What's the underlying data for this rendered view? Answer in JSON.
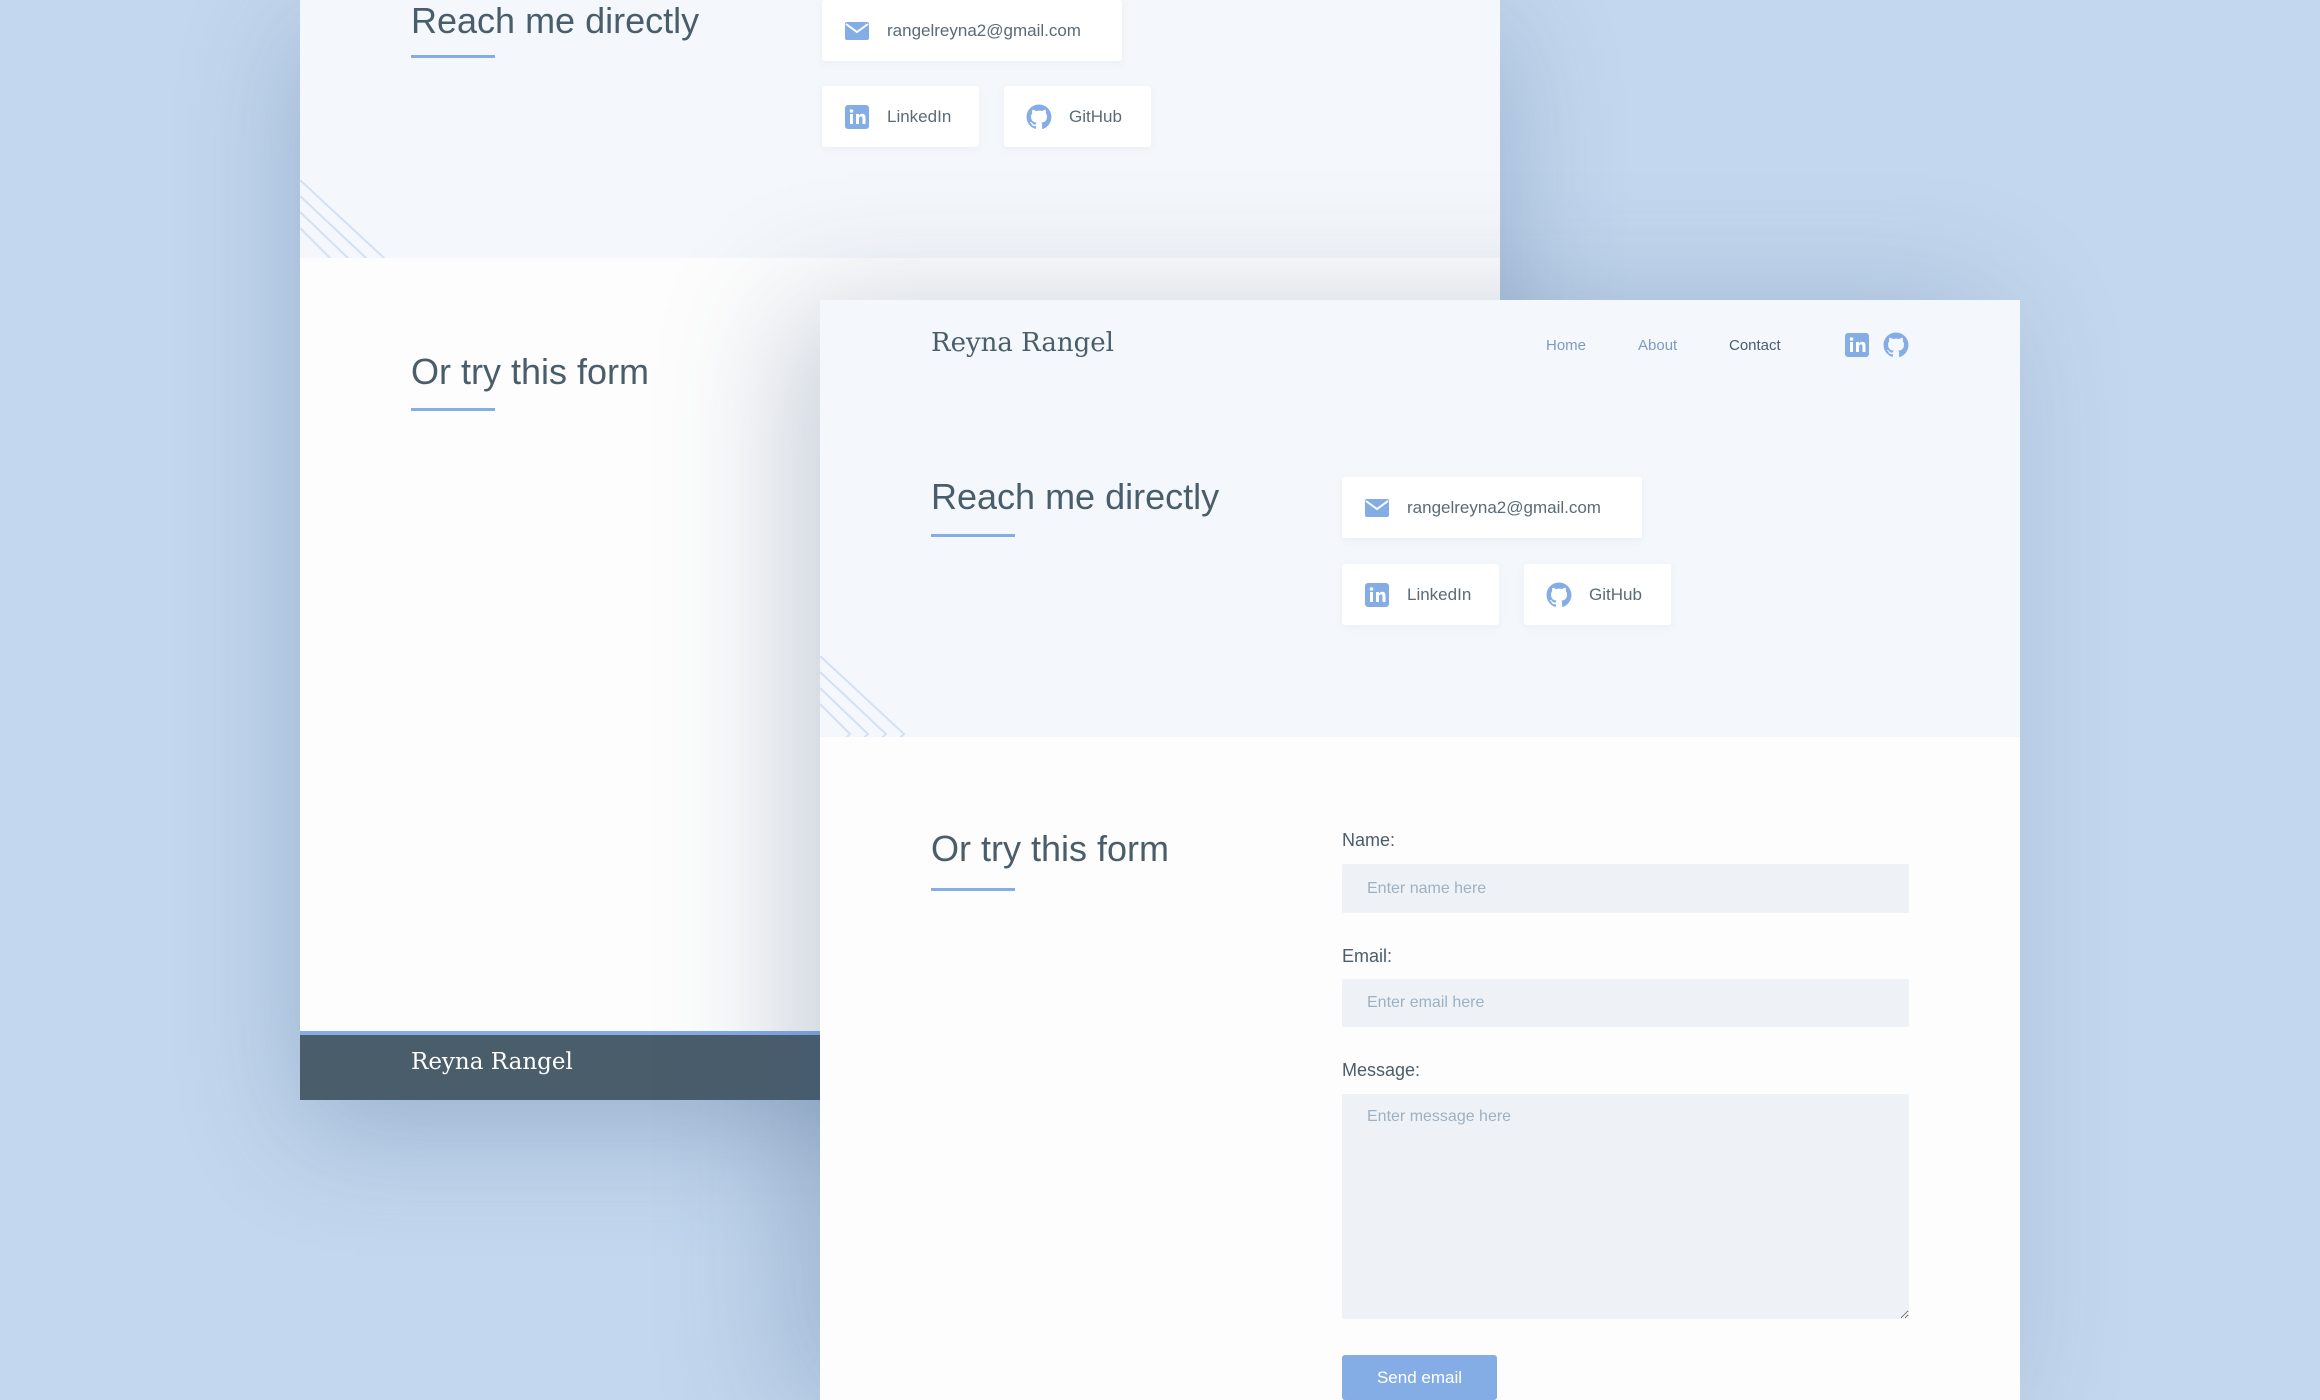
{
  "colors": {
    "background": "#c3d7ee",
    "accent": "#84ade6",
    "text": "#4a5d6b",
    "footer": "#4a5d6b",
    "section_light": "#f4f7fb",
    "input_bg": "#eef2f6"
  },
  "back_window": {
    "reach": {
      "title": "Reach me directly",
      "email": "rangelreyna2@gmail.com",
      "linkedin_label": "LinkedIn",
      "github_label": "GitHub"
    },
    "form_section": {
      "title": "Or try this form"
    },
    "footer": {
      "brand": "Reyna Rangel"
    }
  },
  "front_window": {
    "nav": {
      "brand": "Reyna Rangel",
      "links": [
        {
          "label": "Home",
          "active": false
        },
        {
          "label": "About",
          "active": false
        },
        {
          "label": "Contact",
          "active": true
        }
      ],
      "icons": [
        "linkedin-icon",
        "github-icon"
      ]
    },
    "reach": {
      "title": "Reach me directly",
      "email": "rangelreyna2@gmail.com",
      "linkedin_label": "LinkedIn",
      "github_label": "GitHub"
    },
    "form": {
      "title": "Or try this form",
      "name_label": "Name:",
      "name_placeholder": "Enter name here",
      "email_label": "Email:",
      "email_placeholder": "Enter email here",
      "message_label": "Message:",
      "message_placeholder": "Enter message here",
      "submit_label": "Send email"
    }
  }
}
